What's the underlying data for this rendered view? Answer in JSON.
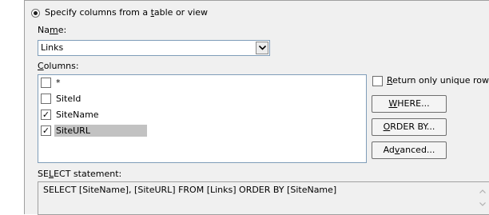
{
  "source_option": {
    "label_pre": "Specify columns from a ",
    "label_acc": "t",
    "label_post": "able or view",
    "selected": true
  },
  "name": {
    "label_pre": "Na",
    "label_acc": "m",
    "label_post": "e:",
    "value": "Links"
  },
  "columns": {
    "label_pre": "",
    "label_acc": "C",
    "label_post": "olumns:",
    "items": [
      {
        "label": "*",
        "checked": false,
        "selected": false
      },
      {
        "label": "SiteId",
        "checked": false,
        "selected": false
      },
      {
        "label": "SiteName",
        "checked": true,
        "selected": false
      },
      {
        "label": "SiteURL",
        "checked": true,
        "selected": true
      }
    ]
  },
  "unique_rows": {
    "label_pre": "",
    "label_acc": "R",
    "label_post": "eturn only unique rows",
    "checked": false
  },
  "buttons": {
    "where": {
      "pre": "",
      "acc": "W",
      "post": "HERE..."
    },
    "order_by": {
      "pre": "",
      "acc": "O",
      "post": "RDER BY..."
    },
    "advanced": {
      "pre": "Ad",
      "acc": "v",
      "post": "anced..."
    }
  },
  "select_statement": {
    "label_pre": "SE",
    "label_acc": "L",
    "label_post": "ECT statement:",
    "sql": "SELECT [SiteName], [SiteURL] FROM [Links] ORDER BY [SiteName]"
  },
  "icons": {
    "dropdown": "chevron-down-icon",
    "scroll_up": "scroll-up-icon",
    "scroll_down": "scroll-down-icon",
    "check": "✓"
  }
}
